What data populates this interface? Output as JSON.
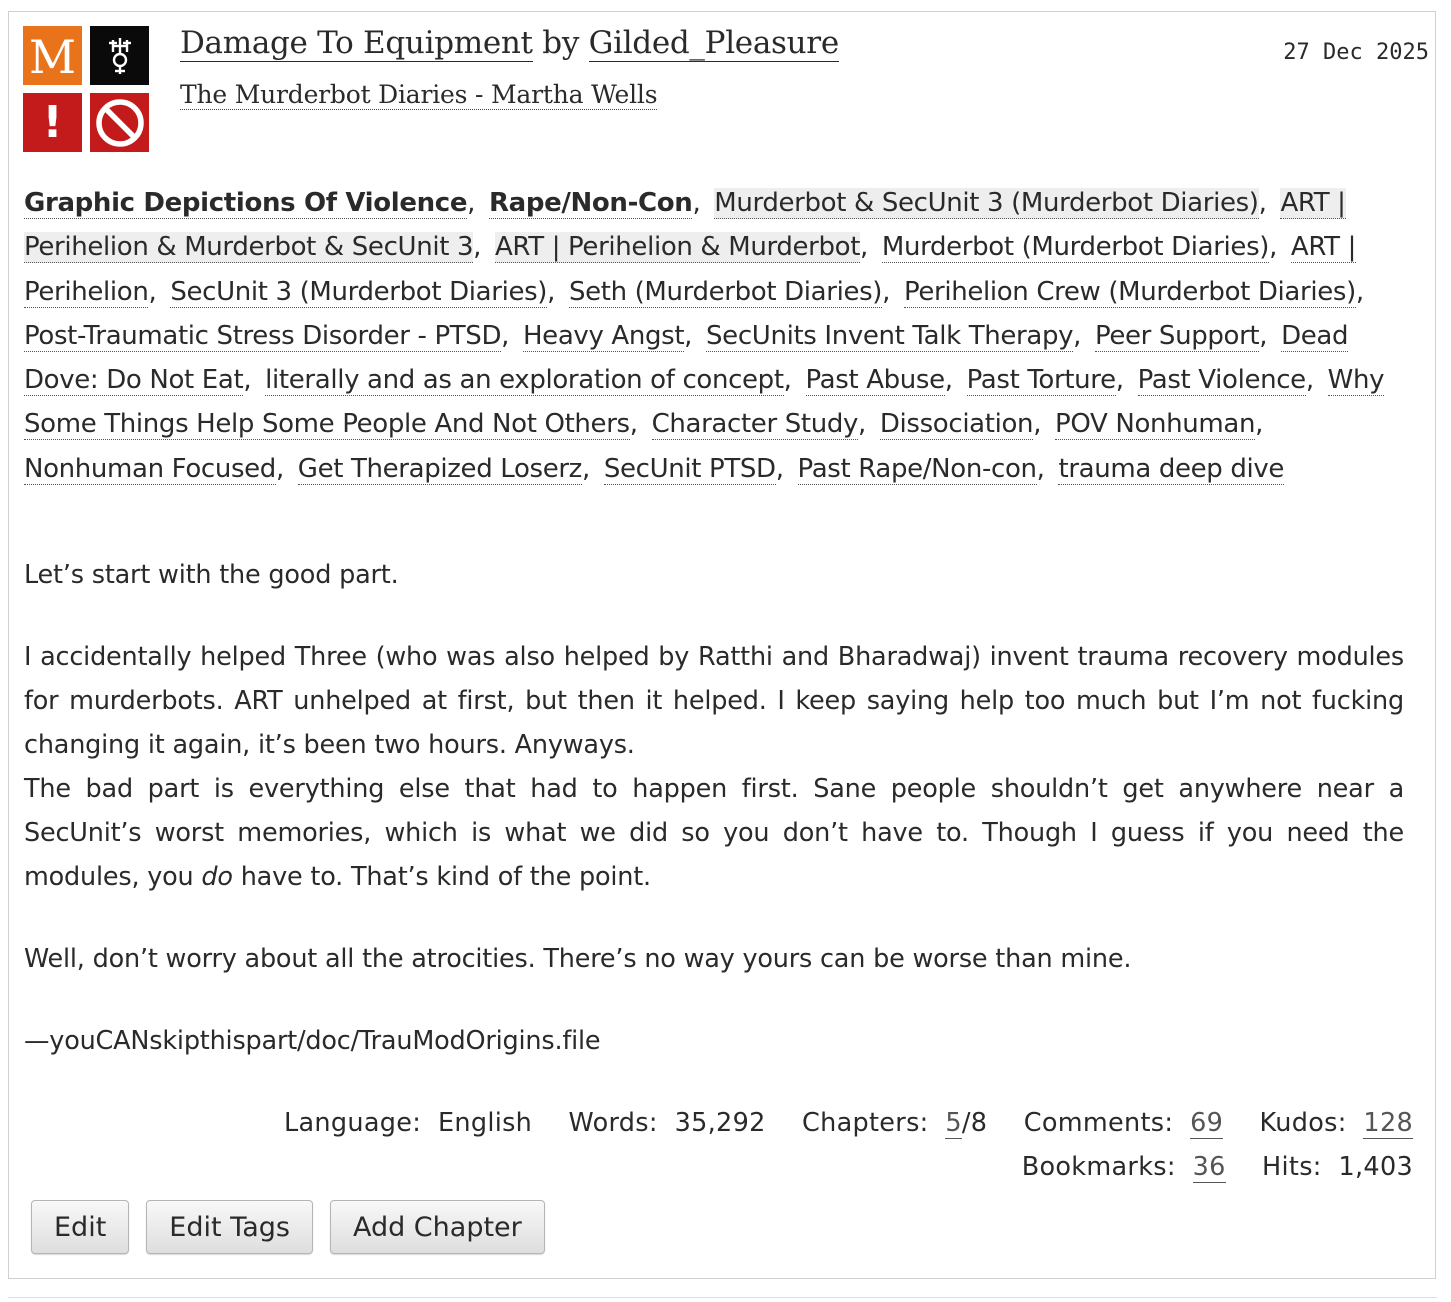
{
  "work": {
    "title": "Damage To Equipment",
    "by_label": "by",
    "author": "Gilded_Pleasure",
    "fandom": "The Murderbot Diaries - Martha Wells",
    "date": "27 Dec 2025",
    "required_tags": {
      "rating": {
        "letter": "M",
        "color": "#e8731a"
      },
      "category": {
        "icon": "category-multi-icon",
        "color": "#0a0a0a"
      },
      "warning": {
        "symbol": "!",
        "color": "#c31b1b"
      },
      "status": {
        "icon": "prohibited-icon",
        "color": "#c31b1b"
      }
    }
  },
  "tags": {
    "warnings": [
      "Graphic Depictions Of Violence",
      "Rape/Non-Con"
    ],
    "relationships": [
      "Murderbot & SecUnit 3 (Murderbot Diaries)",
      "ART | Perihelion & Murderbot & SecUnit 3",
      "ART | Perihelion & Murderbot"
    ],
    "characters": [
      "Murderbot (Murderbot Diaries)",
      "ART | Perihelion",
      "SecUnit 3 (Murderbot Diaries)",
      "Seth (Murderbot Diaries)",
      "Perihelion Crew (Murderbot Diaries)"
    ],
    "freeforms": [
      "Post-Traumatic Stress Disorder - PTSD",
      "Heavy Angst",
      "SecUnits Invent Talk Therapy",
      "Peer Support",
      "Dead Dove: Do Not Eat",
      "literally and as an exploration of concept",
      "Past Abuse",
      "Past Torture",
      "Past Violence",
      "Why Some Things Help Some People And Not Others",
      "Character Study",
      "Dissociation",
      "POV Nonhuman",
      "Nonhuman Focused",
      "Get Therapized Loserz",
      "SecUnit PTSD",
      "Past Rape/Non-con",
      "trauma deep dive"
    ],
    "separator": ","
  },
  "summary": {
    "p1": "Let’s start with the good part.",
    "p2": "I accidentally helped Three (who was also helped by Ratthi and Bharadwaj) invent trauma recovery modules for murderbots. ART unhelped at first, but then it helped. I keep saying help too much but I’m not fucking changing it again, it’s been two hours. Anyways.",
    "p3_before": "The bad part is everything else that had to happen first. Sane people shouldn’t get anywhere near a SecUnit’s worst memories, which is what we did so you don’t have to. Though I guess if you need the modules, you ",
    "p3_em": "do",
    "p3_after": " have to. That’s kind of the point.",
    "p4": "Well, don’t worry about all the atrocities. There’s no way yours can be worse than mine.",
    "p5": "—youCANskipthispart/doc/TrauModOrigins.file"
  },
  "stats": {
    "language_label": "Language:",
    "language": "English",
    "words_label": "Words:",
    "words": "35,292",
    "chapters_label": "Chapters:",
    "chapters_posted": "5",
    "chapters_total": "/8",
    "comments_label": "Comments:",
    "comments": "69",
    "kudos_label": "Kudos:",
    "kudos": "128",
    "bookmarks_label": "Bookmarks:",
    "bookmarks": "36",
    "hits_label": "Hits:",
    "hits": "1,403"
  },
  "actions": {
    "edit": "Edit",
    "edit_tags": "Edit Tags",
    "add_chapter": "Add Chapter"
  }
}
